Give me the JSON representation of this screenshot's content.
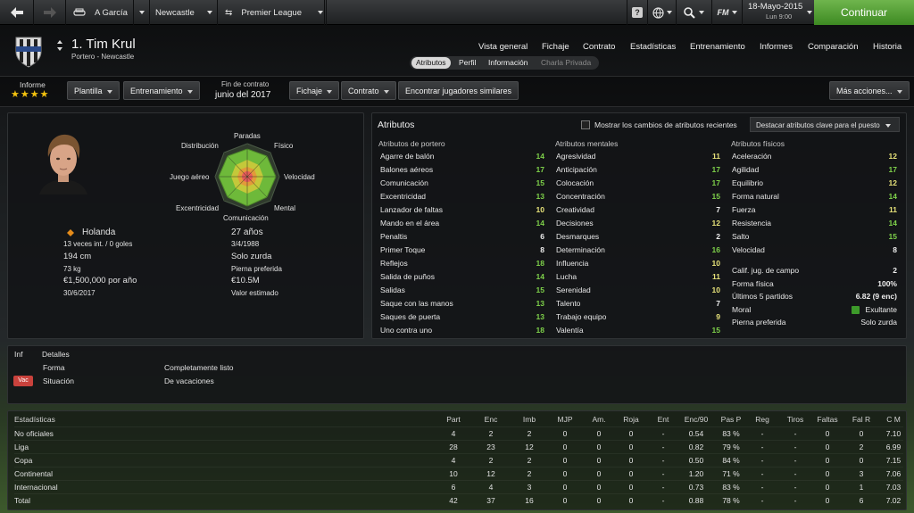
{
  "topbar": {
    "breadcrumb": [
      "A García",
      "Newcastle",
      "Premier League"
    ],
    "date": "18-Mayo-2015",
    "day_time": "Lun 9:00",
    "fm_label": "FM",
    "continue_label": "Continuar"
  },
  "player": {
    "name": "1. Tim Krul",
    "subtitle": "Portero - Newcastle"
  },
  "nav": [
    "Vista general",
    "Fichaje",
    "Contrato",
    "Estadísticas",
    "Entrenamiento",
    "Informes",
    "Comparación",
    "Historia"
  ],
  "subtabs": [
    "Atributos",
    "Perfil",
    "Información",
    "Charla Privada"
  ],
  "toolbar": {
    "informe_label": "Informe",
    "stars": "★★★★",
    "plantilla": "Plantilla",
    "entrenamiento": "Entrenamiento",
    "contract_label": "Fin de contrato",
    "contract_value": "junio del 2017",
    "fichaje": "Fichaje",
    "contrato": "Contrato",
    "find_similar": "Encontrar jugadores similares",
    "more_actions": "Más acciones..."
  },
  "profile": {
    "nation": "Holanda",
    "caps": "13 veces int. / 0 goles",
    "age": "27 años",
    "dob": "3/4/1988",
    "height": "194 cm",
    "foot": "Solo zurda",
    "weight": "73 kg",
    "foot_label": "Pierna preferida",
    "wage": "€1,500,000 por año",
    "value": "€10.5M",
    "contract_end": "30/6/2017",
    "value_label": "Valor estimado"
  },
  "radar": {
    "labels": [
      "Paradas",
      "Físico",
      "Velocidad",
      "Mental",
      "Comunicación",
      "Excentricidad",
      "Juego aéreo",
      "Distribución"
    ]
  },
  "attributes": {
    "title": "Atributos",
    "show_changes": "Mostrar los cambios de atributos recientes",
    "highlight": "Destacar atributos clave para el puesto",
    "groups": [
      {
        "title": "Atributos de portero",
        "items": [
          [
            "Agarre de balón",
            "14"
          ],
          [
            "Balones aéreos",
            "17"
          ],
          [
            "Comunicación",
            "15"
          ],
          [
            "Excentricidad",
            "13"
          ],
          [
            "Lanzador de faltas",
            "10"
          ],
          [
            "Mando en el área",
            "14"
          ],
          [
            "Penaltis",
            "6"
          ],
          [
            "Primer Toque",
            "8"
          ],
          [
            "Reflejos",
            "18"
          ],
          [
            "Salida de puños",
            "14"
          ],
          [
            "Salidas",
            "15"
          ],
          [
            "Saque con las manos",
            "13"
          ],
          [
            "Saques de puerta",
            "13"
          ],
          [
            "Uno contra uno",
            "18"
          ]
        ]
      },
      {
        "title": "Atributos mentales",
        "items": [
          [
            "Agresividad",
            "11"
          ],
          [
            "Anticipación",
            "17"
          ],
          [
            "Colocación",
            "17"
          ],
          [
            "Concentración",
            "15"
          ],
          [
            "Creatividad",
            "7"
          ],
          [
            "Decisiones",
            "12"
          ],
          [
            "Desmarques",
            "2"
          ],
          [
            "Determinación",
            "16"
          ],
          [
            "Influencia",
            "10"
          ],
          [
            "Lucha",
            "11"
          ],
          [
            "Serenidad",
            "10"
          ],
          [
            "Talento",
            "7"
          ],
          [
            "Trabajo equipo",
            "9"
          ],
          [
            "Valentía",
            "15"
          ]
        ]
      },
      {
        "title": "Atributos físicos",
        "items": [
          [
            "Aceleración",
            "12"
          ],
          [
            "Agilidad",
            "17"
          ],
          [
            "Equilibrio",
            "12"
          ],
          [
            "Forma natural",
            "14"
          ],
          [
            "Fuerza",
            "11"
          ],
          [
            "Resistencia",
            "14"
          ],
          [
            "Salto",
            "15"
          ],
          [
            "Velocidad",
            "8"
          ]
        ]
      }
    ],
    "extra": [
      [
        "Calif. jug. de campo",
        "2"
      ],
      [
        "Forma física",
        "100%"
      ],
      [
        "Últimos 5 partidos",
        "6.82 (9 enc)"
      ],
      [
        "Moral",
        "Exultante"
      ],
      [
        "Pierna preferida",
        "Solo zurda"
      ]
    ]
  },
  "details": {
    "inf": "Inf",
    "detalles": "Detalles",
    "rows": [
      [
        "",
        "Forma",
        "Completamente listo"
      ],
      [
        "Vac",
        "Situación",
        "De vacaciones"
      ]
    ]
  },
  "stats": {
    "headers": [
      "Estadísticas",
      "Part",
      "Enc",
      "Imb",
      "MJP",
      "Am.",
      "Roja",
      "Ent",
      "Enc/90",
      "Pas P",
      "Reg",
      "Tiros",
      "Faltas",
      "Fal R",
      "C M"
    ],
    "rows": [
      [
        "No oficiales",
        "4",
        "2",
        "2",
        "0",
        "0",
        "0",
        "-",
        "0.54",
        "83 %",
        "-",
        "-",
        "0",
        "0",
        "7.10"
      ],
      [
        "Liga",
        "28",
        "23",
        "12",
        "0",
        "0",
        "0",
        "-",
        "0.82",
        "79 %",
        "-",
        "-",
        "0",
        "2",
        "6.99"
      ],
      [
        "Copa",
        "4",
        "2",
        "2",
        "0",
        "0",
        "0",
        "-",
        "0.50",
        "84 %",
        "-",
        "-",
        "0",
        "0",
        "7.15"
      ],
      [
        "Continental",
        "10",
        "12",
        "2",
        "0",
        "0",
        "0",
        "-",
        "1.20",
        "71 %",
        "-",
        "-",
        "0",
        "3",
        "7.06"
      ],
      [
        "Internacional",
        "6",
        "4",
        "3",
        "0",
        "0",
        "0",
        "-",
        "0.73",
        "83 %",
        "-",
        "-",
        "0",
        "1",
        "7.03"
      ],
      [
        "Total",
        "42",
        "37",
        "16",
        "0",
        "0",
        "0",
        "-",
        "0.88",
        "78 %",
        "-",
        "-",
        "0",
        "6",
        "7.02"
      ]
    ]
  }
}
